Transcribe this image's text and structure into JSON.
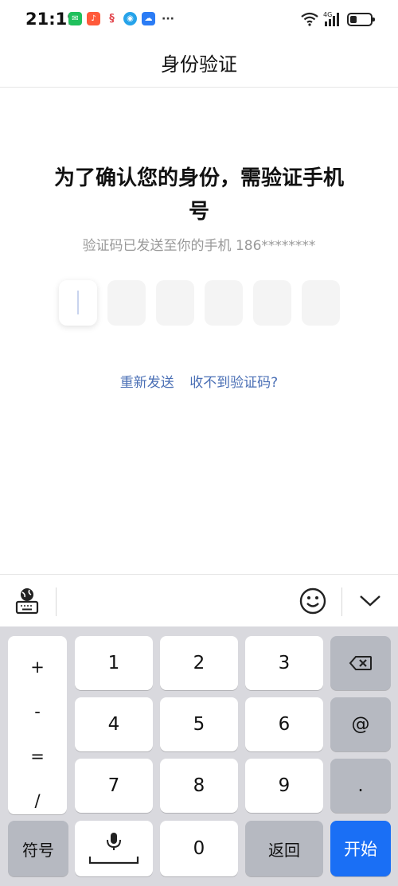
{
  "status_bar": {
    "time": "21:19",
    "notification_icons": [
      "wechat-icon",
      "ting-icon",
      "app-icon",
      "browser-icon",
      "cloud-icon"
    ],
    "more": "···",
    "network": "4G",
    "battery_level": 0.35
  },
  "header": {
    "title": "身份验证"
  },
  "main": {
    "headline": "为了确认您的身份，需验证手机号",
    "subtitle": "验证码已发送至你的手机 186********",
    "code_length": 6,
    "resend_label": "重新发送",
    "not_received_label": "收不到验证码?"
  },
  "toolbar": {
    "keyboard_switch_icon": "globe-keyboard-icon",
    "emoji_icon": "smile-icon",
    "collapse_icon": "chevron-down-icon"
  },
  "keyboard": {
    "symbols": [
      "+",
      "-",
      "=",
      "/"
    ],
    "digits": [
      "1",
      "2",
      "3",
      "4",
      "5",
      "6",
      "7",
      "8",
      "9",
      "0"
    ],
    "at": "@",
    "dot": ".",
    "symbols_key": "符号",
    "back_key": "返回",
    "start_key": "开始",
    "colors": {
      "accent": "#1a6ff5",
      "link": "#4a6fb5"
    }
  }
}
